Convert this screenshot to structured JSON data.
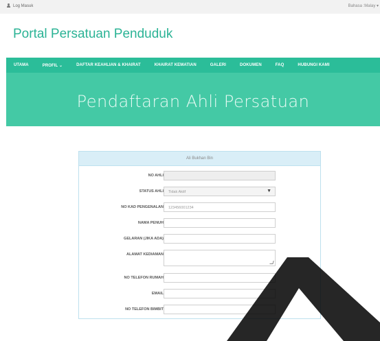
{
  "topbar": {
    "login_label": "Log Masuk",
    "language_label": "Bahasa :Malay ▾"
  },
  "brand": {
    "title": "Portal Persatuan Penduduk"
  },
  "nav": {
    "items": [
      {
        "label": "UTAMA"
      },
      {
        "label": "PROFIL ⌄"
      },
      {
        "label": "DAFTAR KEAHLIAN & KHAIRAT"
      },
      {
        "label": "KHAIRAT KEMATIAN"
      },
      {
        "label": "GALERI"
      },
      {
        "label": "DOKUMEN"
      },
      {
        "label": "FAQ"
      },
      {
        "label": "HUBUNGI KAMI"
      }
    ]
  },
  "hero": {
    "title": "Pendaftaran Ahli Persatuan"
  },
  "form": {
    "header": "Ali Bukhan Bin",
    "fields": [
      {
        "label": "NO AHLI",
        "value": ""
      },
      {
        "label": "STATUS AHLI",
        "value": "Tidak Aktif"
      },
      {
        "label": "NO KAD PENGENALAN",
        "value": "123456001234"
      },
      {
        "label": "NAMA PENUH",
        "value": ""
      },
      {
        "label": "GELARAN (JIKA ADA)",
        "value": ""
      },
      {
        "label": "ALAMAT KEDIAMAN",
        "value": ""
      },
      {
        "label": "NO TELEFON RUMAH",
        "value": ""
      },
      {
        "label": "EMAIL",
        "value": ""
      },
      {
        "label": "NO TELEFON BIMBIT",
        "value": ""
      }
    ]
  },
  "colors": {
    "brand": "#2bb395",
    "navbar": "#2bbd99",
    "hero": "#44c9a5",
    "panel_header": "#d9eef7"
  }
}
